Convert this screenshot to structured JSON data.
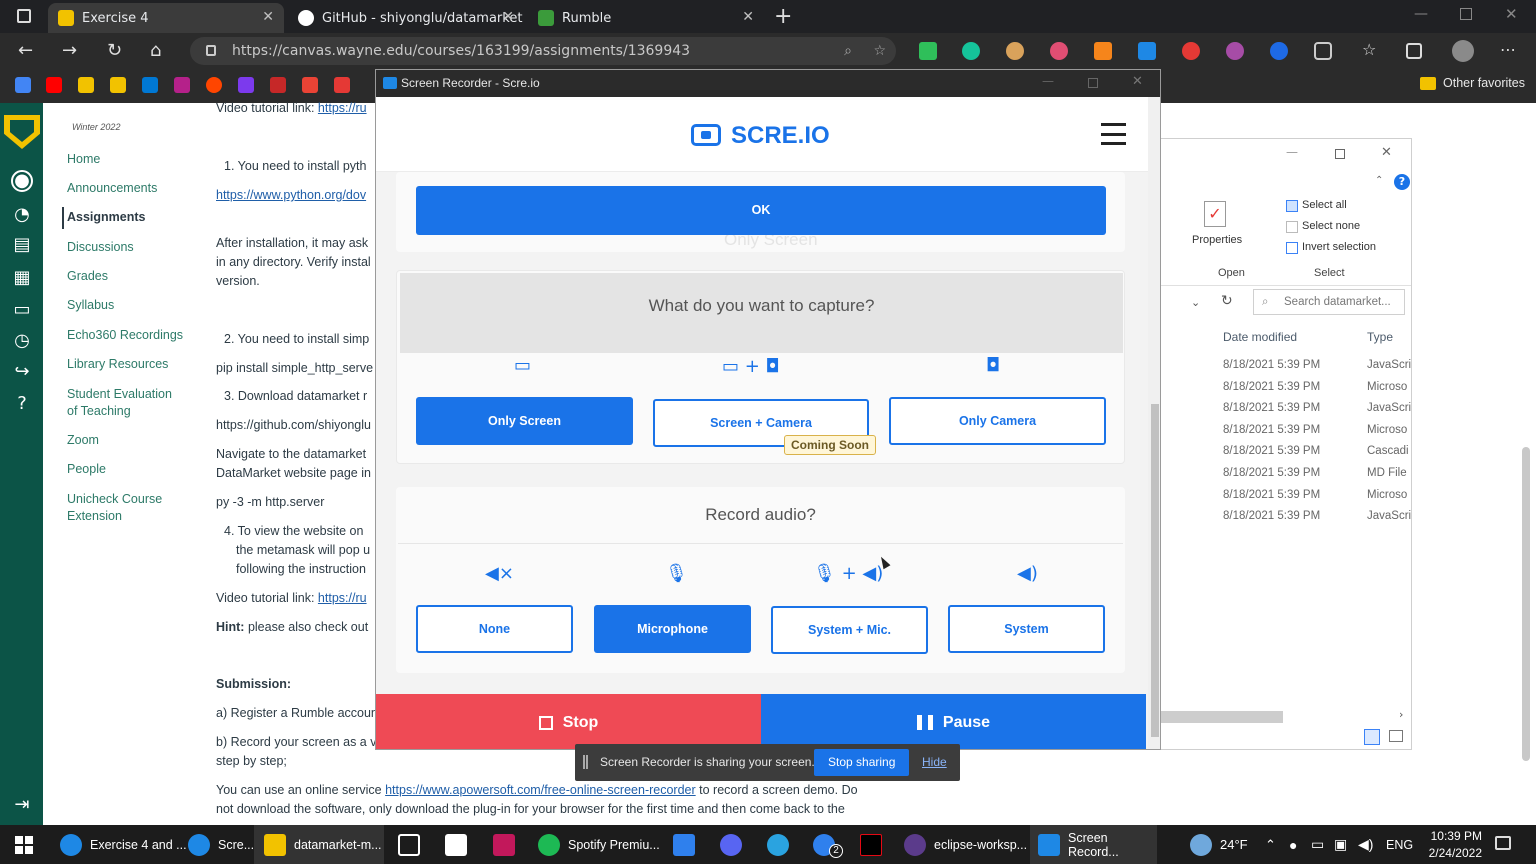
{
  "browser": {
    "tabs": [
      {
        "title": "Exercise 4",
        "active": true,
        "fav_color": "#f2c200"
      },
      {
        "title": "GitHub - shiyonglu/datamarket",
        "active": false,
        "fav_color": "#ffffff"
      },
      {
        "title": "Rumble",
        "active": false,
        "fav_color": "#3b9b3b"
      }
    ],
    "url": "https://canvas.wayne.edu/courses/163199/assignments/1369943",
    "other_favorites": "Other favorites"
  },
  "course_nav": {
    "term": "Winter 2022",
    "items": [
      "Home",
      "Announcements",
      "Assignments",
      "Discussions",
      "Grades",
      "Syllabus",
      "Echo360 Recordings",
      "Library Resources",
      "Student Evaluation of Teaching",
      "Zoom",
      "People",
      "Unicheck Course Extension"
    ],
    "active": "Assignments"
  },
  "assignment": {
    "video_link_label": "Video tutorial link:",
    "video_link": "https://ru",
    "step1": "1.   You need to install pyth",
    "python_link": "https://www.python.org/dov",
    "after_install_1": "After installation, it may ask",
    "after_install_2": "in any directory. Verify instal",
    "after_install_3": "version.",
    "step2": "2.   You need to install simp",
    "pip": "pip install simple_http_serve",
    "step3": "3.   Download datamarket r",
    "github_url": "https://github.com/shiyonglu",
    "navigate_1": "Navigate to the datamarket",
    "navigate_2": "DataMarket website page in",
    "py_cmd": "py -3 -m http.server",
    "step4_1": "4.   To view the website on",
    "step4_2": "the metamask will pop u",
    "step4_3": "following the instruction",
    "video_link2": "https://ru",
    "hint_label": "Hint:",
    "hint_text": "please also check out",
    "submission": "Submission:",
    "sub_a": "a) Register a Rumble accoun",
    "sub_b1": "b) Record your screen as a vi",
    "sub_b2": "step by step;",
    "online_1_pre": "You can use an online service",
    "online_link": "https://www.apowersoft.com/free-online-screen-recorder",
    "online_1_post": "to record a screen demo. Do",
    "online_2": "not download the software, only download the plug-in for your browser for the first time and then come back to the"
  },
  "explorer": {
    "select_all": "Select all",
    "select_none": "Select none",
    "invert_selection": "Invert selection",
    "properties": "Properties",
    "open_group": "Open",
    "select_group": "Select",
    "search_placeholder": "Search datamarket...",
    "col_date": "Date modified",
    "col_type": "Type",
    "rows": [
      {
        "date": "8/18/2021 5:39 PM",
        "type": "JavaScri"
      },
      {
        "date": "8/18/2021 5:39 PM",
        "type": "Microso"
      },
      {
        "date": "8/18/2021 5:39 PM",
        "type": "JavaScri"
      },
      {
        "date": "8/18/2021 5:39 PM",
        "type": "Microso"
      },
      {
        "date": "8/18/2021 5:39 PM",
        "type": "Cascadi"
      },
      {
        "date": "8/18/2021 5:39 PM",
        "type": "MD File"
      },
      {
        "date": "8/18/2021 5:39 PM",
        "type": "Microso"
      },
      {
        "date": "8/18/2021 5:39 PM",
        "type": "JavaScri"
      }
    ]
  },
  "recorder": {
    "window_title": "Screen Recorder - Scre.io",
    "brand": "SCRE.IO",
    "ok": "OK",
    "ghost_only_screen": "Only Screen",
    "capture_question": "What do you want to capture?",
    "capture_options": [
      "Only Screen",
      "Screen + Camera",
      "Only Camera"
    ],
    "capture_selected": "Only Screen",
    "coming_soon": "Coming Soon",
    "audio_question": "Record audio?",
    "audio_options": [
      "None",
      "Microphone",
      "System + Mic.",
      "System"
    ],
    "audio_selected": "Microphone",
    "stop": "Stop",
    "pause": "Pause",
    "accent": "#1a73e8",
    "stop_color": "#ef4a55"
  },
  "share_bar": {
    "message": "Screen Recorder is sharing your screen.",
    "stop_sharing": "Stop sharing",
    "hide": "Hide"
  },
  "taskbar": {
    "apps": [
      {
        "label": "Exercise 4 and ...",
        "color": "#1e88e5"
      },
      {
        "label": "Scre...",
        "color": "#1e88e5"
      },
      {
        "label": "datamarket-m...",
        "color": "#f2c200"
      },
      {
        "label": "",
        "color": "#ffffff"
      },
      {
        "label": "",
        "color": "#ffffff"
      },
      {
        "label": "",
        "color": "#c2185b"
      },
      {
        "label": "Spotify Premiu...",
        "color": "#1db954"
      },
      {
        "label": "",
        "color": "#2f80ed"
      },
      {
        "label": "",
        "color": "#5865f2"
      },
      {
        "label": "",
        "color": "#2aa3e0"
      },
      {
        "label": "2",
        "color": "#2f80ed"
      },
      {
        "label": "",
        "color": "#e50914"
      },
      {
        "label": "eclipse-worksp...",
        "color": "#5b3b8b"
      },
      {
        "label": "Screen Record...",
        "color": "#1e88e5"
      }
    ],
    "weather": "24°F",
    "lang": "ENG",
    "time": "10:39 PM",
    "date": "2/24/2022"
  }
}
